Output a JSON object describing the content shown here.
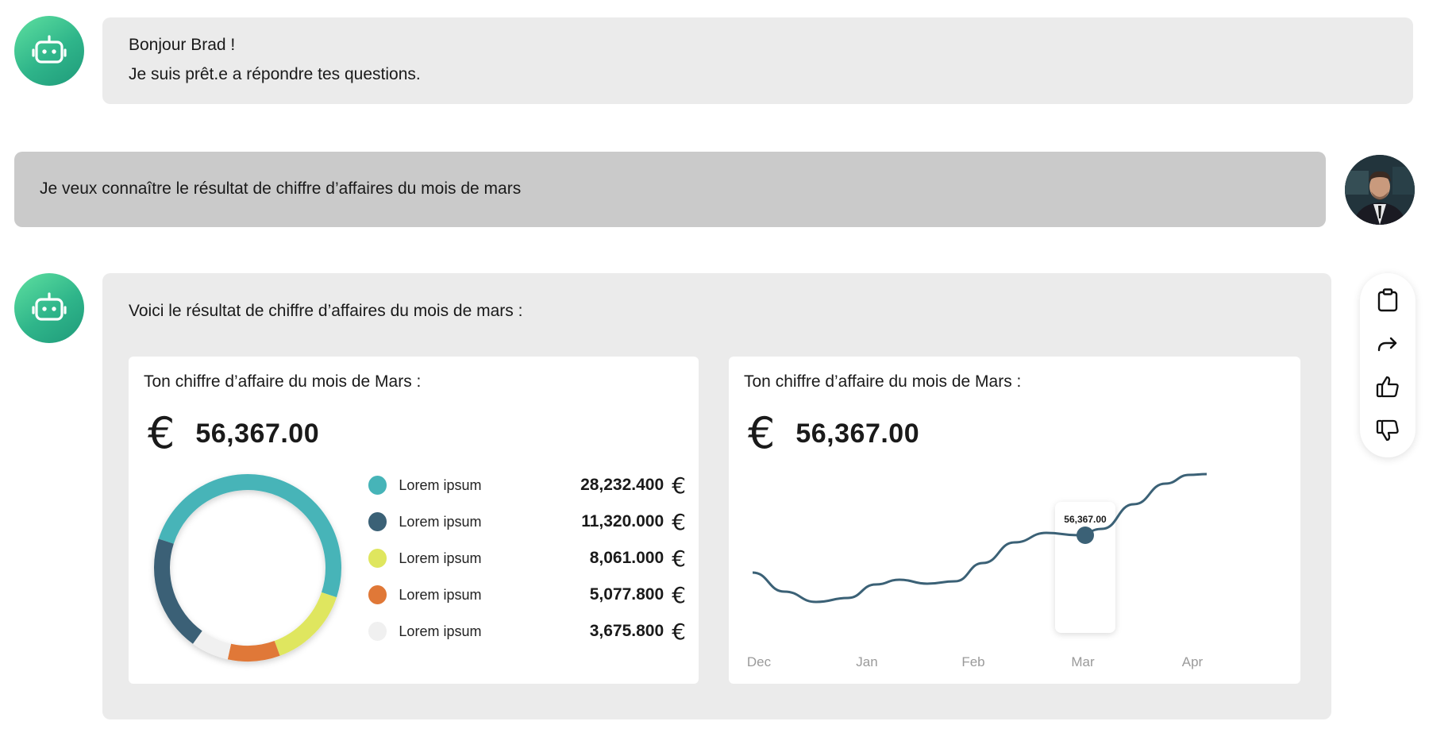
{
  "greeting": {
    "line1": "Bonjour Brad !",
    "line2": "Je suis prêt.e a répondre tes questions."
  },
  "user_message": {
    "text": "Je veux connaître le résultat de chiffre d’affaires du mois de mars"
  },
  "bot_reply": {
    "text": "Voici le résultat de chiffre d’affaires du mois de mars :"
  },
  "donut_card": {
    "title": "Ton chiffre d’affaire du mois de Mars :",
    "currency_symbol": "€",
    "total": "56,367.00",
    "legend": [
      {
        "label": "Lorem ipsum",
        "value": "28,232.400",
        "currency": "€",
        "color": "#46b4b8"
      },
      {
        "label": "Lorem ipsum",
        "value": "11,320.000",
        "currency": "€",
        "color": "#3b6176"
      },
      {
        "label": "Lorem ipsum",
        "value": "8,061.000",
        "currency": "€",
        "color": "#dfe65e"
      },
      {
        "label": "Lorem ipsum",
        "value": "5,077.800",
        "currency": "€",
        "color": "#e07837"
      },
      {
        "label": "Lorem ipsum",
        "value": "3,675.800",
        "currency": "€",
        "color": "#f0f0f0"
      }
    ]
  },
  "line_card": {
    "title": "Ton chiffre d’affaire du mois de Mars :",
    "currency_symbol": "€",
    "total": "56,367.00",
    "tooltip_value": "56,367.00"
  },
  "chart_data": [
    {
      "type": "pie",
      "title": "Ton chiffre d’affaire du mois de Mars :",
      "categories": [
        "Lorem ipsum",
        "Lorem ipsum",
        "Lorem ipsum",
        "Lorem ipsum",
        "Lorem ipsum"
      ],
      "values": [
        28232.4,
        11320.0,
        8061.0,
        5077.8,
        3675.8
      ],
      "colors": [
        "#46b4b8",
        "#3b6176",
        "#dfe65e",
        "#e07837",
        "#f0f0f0"
      ]
    },
    {
      "type": "line",
      "title": "Ton chiffre d’affaire du mois de Mars :",
      "categories": [
        "Dec",
        "Jan",
        "Feb",
        "Mar",
        "Apr"
      ],
      "series": [
        {
          "values": [
            38000,
            40500,
            44000,
            56367,
            67000
          ],
          "color": "#3b6176"
        }
      ],
      "highlight": {
        "category": "Mar",
        "value": 56367
      },
      "ylim": [
        30000,
        72000
      ],
      "grid": false
    }
  ],
  "actions": {
    "icons": [
      "clipboard-icon",
      "share-icon",
      "thumbs-up-icon",
      "thumbs-down-icon"
    ]
  }
}
